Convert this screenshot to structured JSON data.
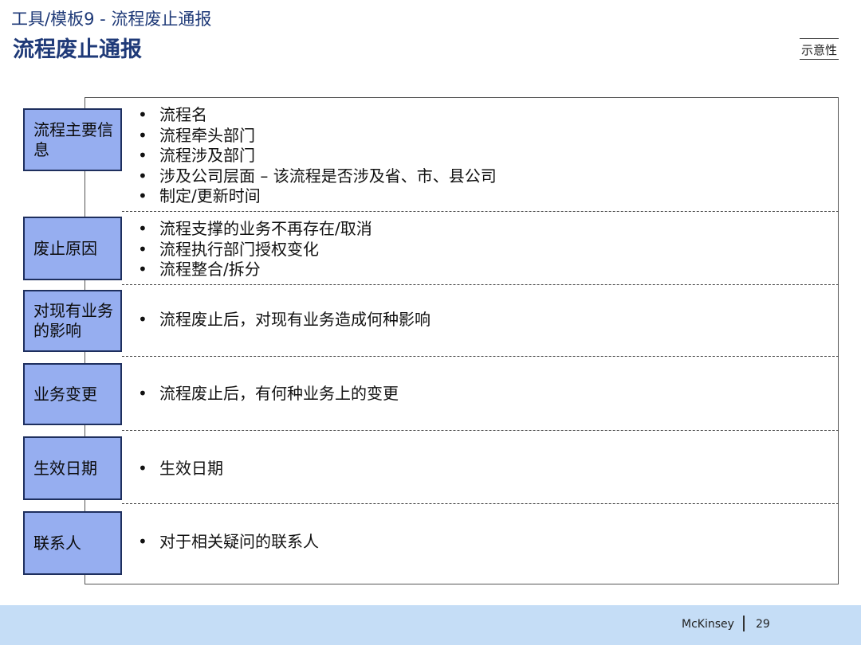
{
  "header": {
    "subtitle": "工具/模板9 - 流程废止通报",
    "title": "流程废止通报",
    "tag": "示意性"
  },
  "rows": [
    {
      "label": "流程主要信息",
      "bullets": [
        "流程名",
        "流程牵头部门",
        "流程涉及部门",
        "涉及公司层面 – 该流程是否涉及省、市、县公司",
        "制定/更新时间"
      ]
    },
    {
      "label": "废止原因",
      "bullets": [
        "流程支撑的业务不再存在/取消",
        "流程执行部门授权变化",
        "流程整合/拆分"
      ]
    },
    {
      "label": "对现有业务的影响",
      "bullets": [
        "流程废止后，对现有业务造成何种影响"
      ]
    },
    {
      "label": "业务变更",
      "bullets": [
        "流程废止后，有何种业务上的变更"
      ]
    },
    {
      "label": "生效日期",
      "bullets": [
        "生效日期"
      ]
    },
    {
      "label": "联系人",
      "bullets": [
        "对于相关疑问的联系人"
      ]
    }
  ],
  "footer": {
    "brand": "McKinsey",
    "page_number": "29"
  }
}
